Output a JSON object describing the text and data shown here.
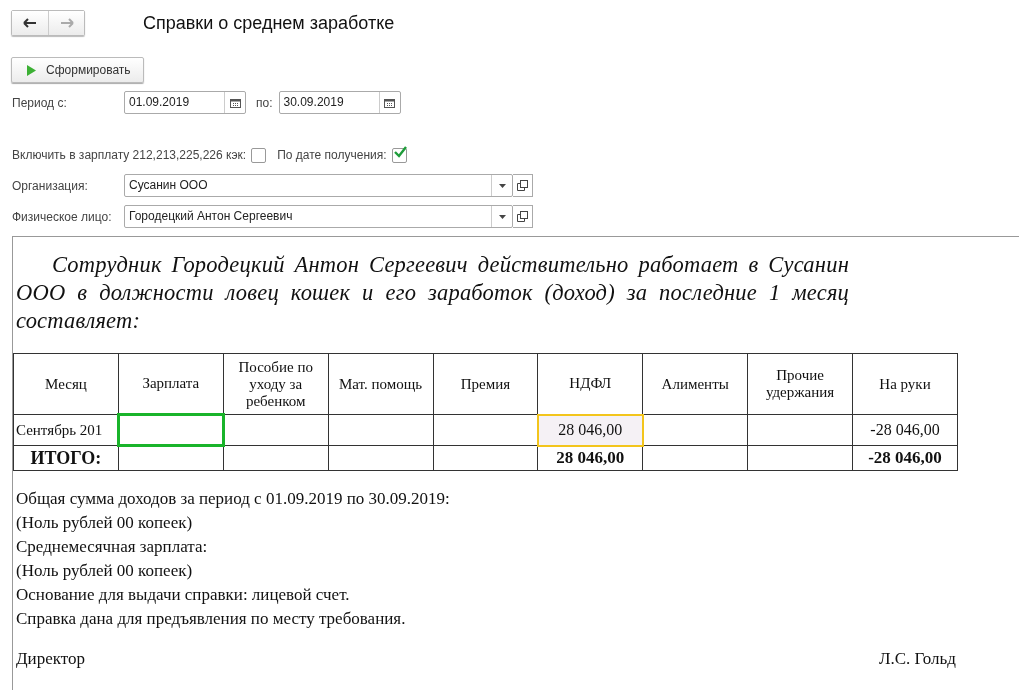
{
  "nav": {
    "back_disabled": false,
    "forward_disabled": true
  },
  "title": "Справки о среднем заработке",
  "generate_button": "Сформировать",
  "period": {
    "from_label": "Период с:",
    "from_value": "01.09.2019",
    "to_label": "по:",
    "to_value": "30.09.2019"
  },
  "include_kek": {
    "label": "Включить в зарплату 212,213,225,226 кэк:",
    "checked": false
  },
  "by_receipt_date": {
    "label": "По дате получения:",
    "checked": true
  },
  "organization": {
    "label": "Организация:",
    "value": "Сусанин ООО"
  },
  "person": {
    "label": "Физическое лицо:",
    "value": "Городецкий Антон Сергеевич"
  },
  "report": {
    "intro": "Сотрудник Городецкий Антон Сергеевич действительно работает в Сусанин ООО в должности ловец кошек и его заработок (доход) за последние 1 месяц составляет:",
    "columns": [
      "Месяц",
      "Зарплата",
      "Пособие по уходу за ребенком",
      "Мат. помощь",
      "Премия",
      "НДФЛ",
      "Алименты",
      "Прочие удержания",
      "На руки"
    ],
    "row": [
      {
        "text": "Сентябрь 201",
        "selected": false,
        "highlighted": false
      },
      {
        "selected": true,
        "highlighted": false
      },
      {
        "selected": false,
        "highlighted": false
      },
      {
        "selected": false,
        "highlighted": false
      },
      {
        "selected": false,
        "highlighted": false
      },
      {
        "text": "28 046,00",
        "selected": false,
        "highlighted": true
      },
      {
        "selected": false,
        "highlighted": false
      },
      {
        "selected": false,
        "highlighted": false
      },
      {
        "text": "-28 046,00",
        "selected": false,
        "highlighted": false
      }
    ],
    "total": {
      "label": "ИТОГО:",
      "ndfl": "28 046,00",
      "net": "-28 046,00"
    },
    "lines": [
      "Общая сумма доходов за период с 01.09.2019 по 30.09.2019:",
      "(Ноль рублей 00 копеек)",
      "Среднемесячная зарплата:",
      "(Ноль рублей 00 копеек)",
      "Основание для выдачи справки: лицевой счет.",
      "Справка дана для предъявления по месту требования."
    ],
    "signer_title": "Директор",
    "signer_name": "Л.С. Гольд"
  }
}
